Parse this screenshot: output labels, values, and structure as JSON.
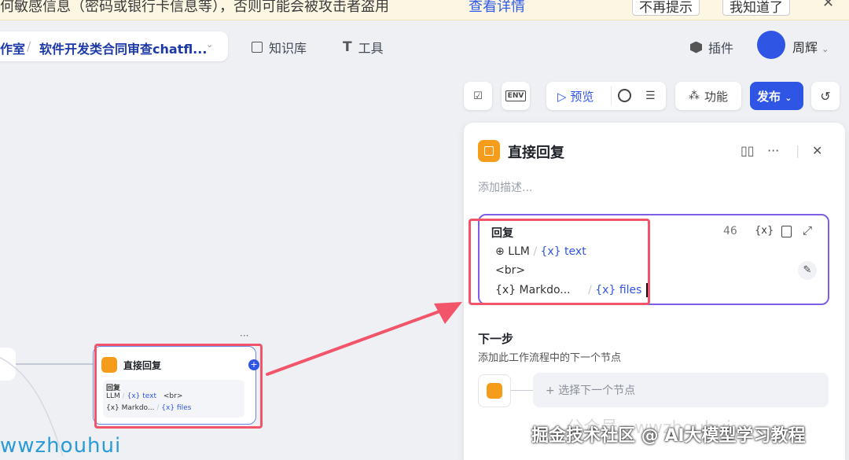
{
  "banner": {
    "text": "何敏感信息（密码或银行卡信息等），否则可能会被攻击者盗用",
    "link": "查看详情",
    "dismiss_forever": "不再提示",
    "acknowledge": "我知道了",
    "close": "✕"
  },
  "nav": {
    "breadcrumb_studio": "作室",
    "breadcrumb_sep": "/",
    "breadcrumb_app": "软件开发类合同审查chatfl...",
    "knowledge": "知识库",
    "tools": "工具",
    "plugins": "插件",
    "user_name": "周辉"
  },
  "toolbar": {
    "env_label": "ENV",
    "preview": "预览",
    "features": "功能",
    "publish": "发布"
  },
  "panel": {
    "title": "直接回复",
    "description_placeholder": "添加描述...",
    "reply": {
      "label": "回复",
      "char_count": "46",
      "var_icon": "{x}",
      "line1": {
        "source": "LLM",
        "sep": "/",
        "var": "{x} text"
      },
      "line2": "<br>",
      "line3": {
        "source": "{x} Markdo...",
        "sep": "/",
        "var": "{x} files"
      }
    },
    "next_step": {
      "title": "下一步",
      "description": "添加此工作流程中的下一个节点",
      "select_placeholder": "选择下一个节点"
    }
  },
  "canvas_node": {
    "title": "直接回复",
    "reply_label": "回复",
    "line1": {
      "source": "LLM",
      "sep": "/",
      "var": "{x} text",
      "extra": "<br>"
    },
    "line2": {
      "source": "{x} Markdo...",
      "sep": "/",
      "var": "{x} files"
    }
  },
  "watermarks": {
    "left": "wwzhouhui",
    "right": "掘金技术社区 @ AI大模型学习教程",
    "faint": "公众号 · wwzhouhui"
  },
  "colors": {
    "accent": "#2f55e4",
    "node_orange": "#f59c1a",
    "highlight": "#f2556a",
    "editor_border": "#7f5ee6"
  }
}
